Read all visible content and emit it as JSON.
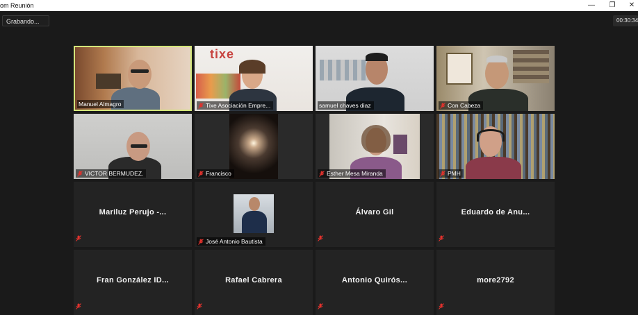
{
  "window": {
    "title": "om Reunión",
    "minimize_icon": "minimize-icon",
    "restore_icon": "restore-icon",
    "close_icon": "close-icon"
  },
  "toolbar": {
    "recording_label": "Grabando...",
    "elapsed_time": "00:30:34"
  },
  "participants": [
    {
      "name": "Manuel Almagro",
      "video": true,
      "muted": false
    },
    {
      "name": "Tixe Asociación Empre...",
      "video": true,
      "muted": true
    },
    {
      "name": "samuel chaves diaz",
      "video": true,
      "muted": false
    },
    {
      "name": "Con Cabeza",
      "video": true,
      "muted": true
    },
    {
      "name": "VICTOR BERMUDEZ.",
      "video": true,
      "muted": true
    },
    {
      "name": "Francisco",
      "video": true,
      "muted": true
    },
    {
      "name": "Esther Mesa Miranda",
      "video": true,
      "muted": true
    },
    {
      "name": "PMH",
      "video": true,
      "muted": true
    },
    {
      "name": "Mariluz Perujo -...",
      "video": false,
      "muted": true
    },
    {
      "name": "José Antonio Bautista",
      "video": true,
      "muted": true
    },
    {
      "name": "Álvaro Gil",
      "video": false,
      "muted": true
    },
    {
      "name": "Eduardo de Anu...",
      "video": false,
      "muted": true
    },
    {
      "name": "Fran González ID...",
      "video": false,
      "muted": true
    },
    {
      "name": "Rafael Cabrera",
      "video": false,
      "muted": true
    },
    {
      "name": "Antonio Quirós...",
      "video": false,
      "muted": true
    },
    {
      "name": "more2792",
      "video": false,
      "muted": true
    }
  ],
  "colors": {
    "active_speaker_border": "#d4e67a",
    "muted_mic": "#e0322d",
    "tile_bg": "#232323"
  }
}
